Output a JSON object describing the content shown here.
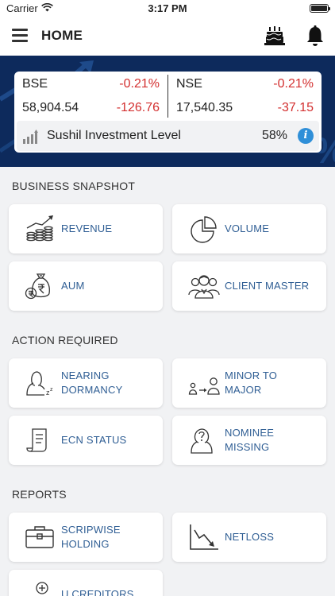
{
  "status_bar": {
    "carrier": "Carrier",
    "time": "3:17 PM"
  },
  "header": {
    "title": "HOME"
  },
  "market": {
    "bse": {
      "name": "BSE",
      "pct": "-0.21%",
      "value": "58,904.54",
      "change": "-126.76"
    },
    "nse": {
      "name": "NSE",
      "pct": "-0.21%",
      "value": "17,540.35",
      "change": "-37.15"
    },
    "investment": {
      "label": "Sushil Investment Level",
      "pct": "58%"
    }
  },
  "sections": {
    "business": {
      "title": "BUSINESS SNAPSHOT",
      "revenue": "REVENUE",
      "volume": "VOLUME",
      "aum": "AUM",
      "client_master": "CLIENT MASTER"
    },
    "action": {
      "title": "ACTION REQUIRED",
      "nearing_1": "NEARING",
      "nearing_2": "DORMANCY",
      "minor_1": "MINOR TO",
      "minor_2": "MAJOR",
      "ecn": "ECN STATUS",
      "nominee_1": "NOMINEE",
      "nominee_2": "MISSING"
    },
    "reports": {
      "title": "REPORTS",
      "scrip_1": "SCRIPWISE",
      "scrip_2": "HOLDING",
      "netloss": "NETLOSS",
      "creditors": "U CREDITORS"
    }
  },
  "colors": {
    "accent": "#2f5e94",
    "negative": "#d32f2f",
    "banner": "#0d2a5c",
    "info": "#2f8fd8"
  },
  "icons": [
    "menu-icon",
    "cake-icon",
    "bell-icon",
    "bars-icon",
    "info-icon",
    "revenue-icon",
    "pie-chart-icon",
    "money-bag-icon",
    "users-icon",
    "sleeping-user-icon",
    "minor-to-major-icon",
    "document-icon",
    "question-user-icon",
    "briefcase-icon",
    "decline-chart-icon",
    "database-plus-icon"
  ]
}
